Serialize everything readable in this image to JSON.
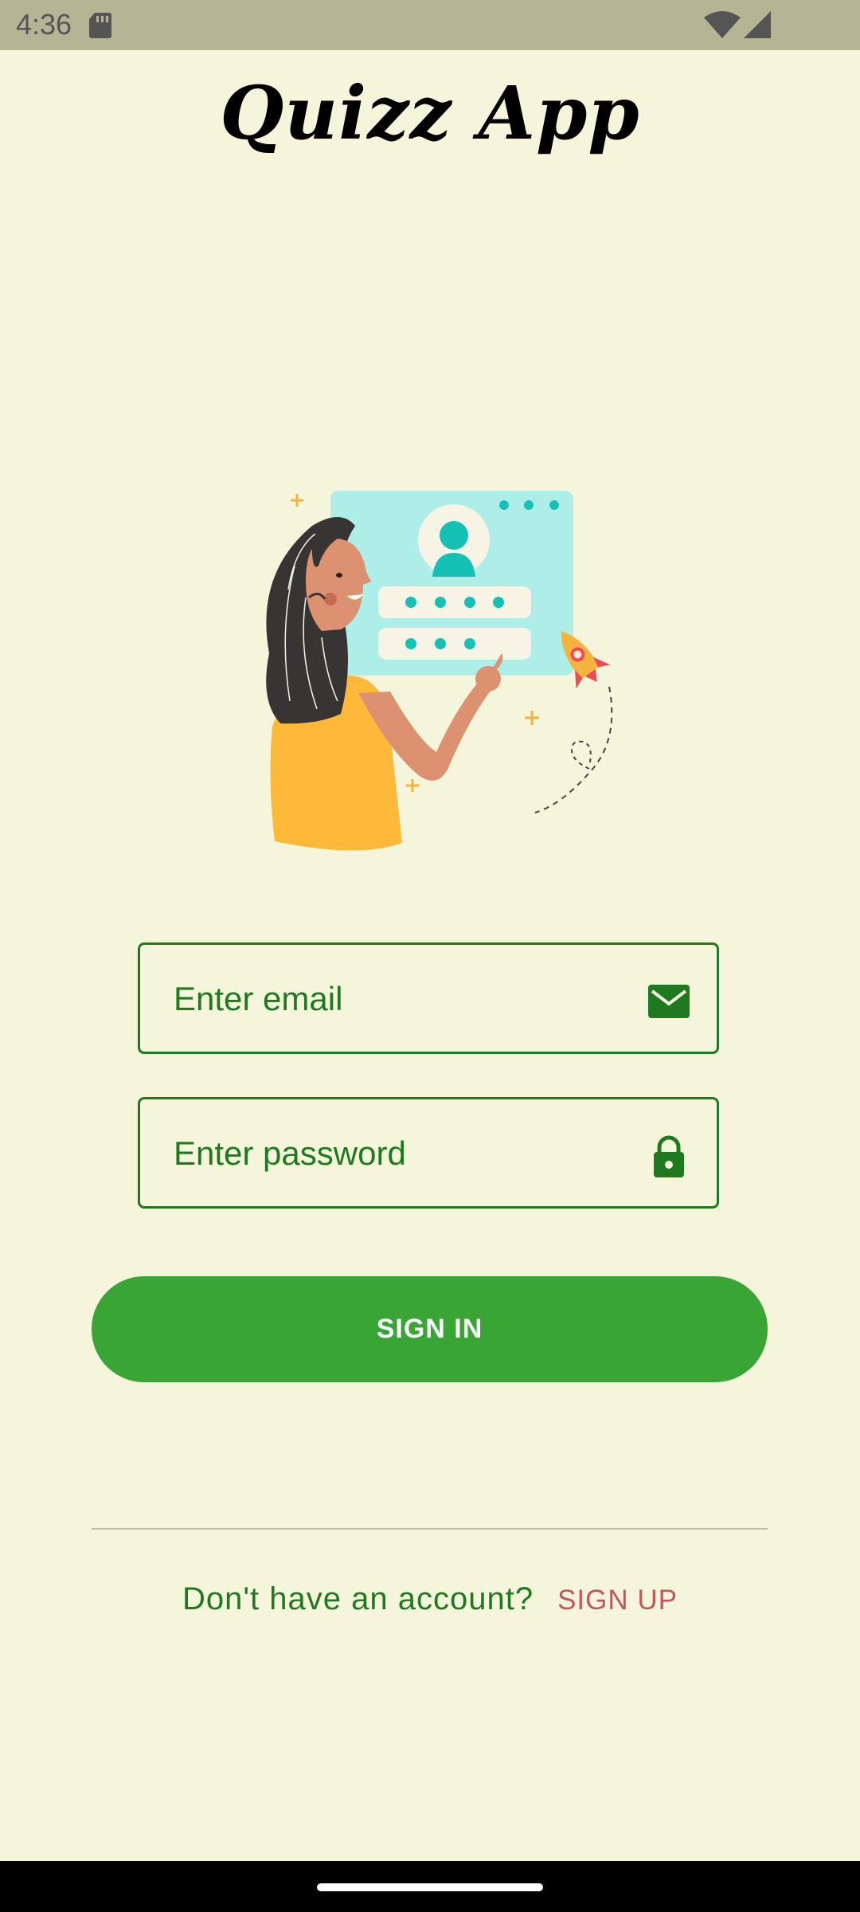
{
  "status_bar": {
    "time": "4:36"
  },
  "app": {
    "title": "Quizz App"
  },
  "login": {
    "email_placeholder": "Enter email",
    "password_placeholder": "Enter password",
    "sign_in_label": "SIGN IN",
    "no_account_text": "Don't have an account?",
    "sign_up_label": "SIGN UP"
  },
  "icons": {
    "email": "envelope-icon",
    "password": "lock-icon"
  },
  "colors": {
    "background": "#f5f5dc",
    "status_bar": "#b3b594",
    "primary_green": "#38a535",
    "field_green": "#1f7a1f",
    "sign_up_red": "#c0585c"
  }
}
